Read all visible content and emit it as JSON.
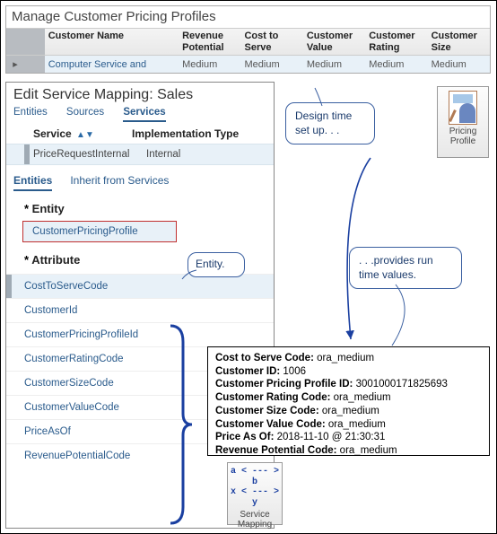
{
  "profiles": {
    "title": "Manage Customer Pricing Profiles",
    "headers": {
      "name": "Customer Name",
      "rev": "Revenue Potential",
      "cost": "Cost to Serve",
      "value": "Customer Value",
      "rating": "Customer Rating",
      "size": "Customer Size"
    },
    "row": {
      "name": "Computer Service and",
      "rev": "Medium",
      "cost": "Medium",
      "value": "Medium",
      "rating": "Medium",
      "size": "Medium"
    }
  },
  "pricing_profile_btn": {
    "line1": "Pricing",
    "line2": "Profile"
  },
  "esm": {
    "title": "Edit Service Mapping: Sales",
    "tabs": {
      "entities": "Entities",
      "sources": "Sources",
      "services": "Services"
    },
    "grid_head": {
      "service": "Service",
      "impl": "Implementation Type"
    },
    "row": {
      "service": "PriceRequestInternal",
      "impl": "Internal"
    },
    "subtabs": {
      "entities": "Entities",
      "inherit": "Inherit from Services"
    },
    "section_entity": "Entity",
    "entity_chip": "CustomerPricingProfile",
    "section_attribute": "Attribute",
    "attributes": [
      "CostToServeCode",
      "CustomerId",
      "CustomerPricingProfileId",
      "CustomerRatingCode",
      "CustomerSizeCode",
      "CustomerValueCode",
      "PriceAsOf",
      "RevenuePotentialCode"
    ]
  },
  "balloons": {
    "entity": "Entity.",
    "design": "Design time set up. . .",
    "runtime": ". . .provides  run time values."
  },
  "output": {
    "rows": [
      {
        "k": "Cost  to  Serve Code:",
        "v": "ora_medium"
      },
      {
        "k": "Customer  ID:",
        "v": "1006"
      },
      {
        "k": "Customer  Pricing Profile ID:",
        "v": "3001000171825693"
      },
      {
        "k": "Customer  Rating Code:",
        "v": "ora_medium"
      },
      {
        "k": "Customer  Size Code:",
        "v": "ora_medium"
      },
      {
        "k": "Customer  Value Code:",
        "v": "ora_medium"
      },
      {
        "k": "Price As  Of:",
        "v": "2018-11-10  @ 21:30:31"
      },
      {
        "k": "Revenue Potential Code:",
        "v": "ora_medium"
      }
    ]
  },
  "svc_map_btn": {
    "line1": "a < --- > b",
    "line2": "x < --- > y",
    "label1": "Service",
    "label2": "Mapping"
  }
}
